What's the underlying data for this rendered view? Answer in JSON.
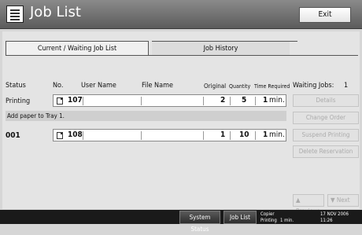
{
  "title_bar": {
    "title": "Job List",
    "exit_label": "Exit"
  },
  "tabs": [
    {
      "label": "Current / Waiting Job List",
      "active": true
    },
    {
      "label": "Job History",
      "active": false
    }
  ],
  "columns": {
    "status": "Status",
    "no": "No.",
    "user_name": "User Name",
    "file_name": "File Name",
    "original": "Original",
    "quantity": "Quantity",
    "time_required": "Time Required"
  },
  "waiting_jobs": {
    "label": "Waiting Jobs:",
    "count": "1"
  },
  "jobs": [
    {
      "status": "Printing",
      "no": "107",
      "user_name": "",
      "file_name": "",
      "original": "2",
      "quantity": "5",
      "time": "1",
      "time_unit": "min."
    },
    {
      "status": "001",
      "no": "108",
      "user_name": "",
      "file_name": "",
      "original": "1",
      "quantity": "10",
      "time": "1",
      "time_unit": "min."
    }
  ],
  "message": "Add paper to Tray 1.",
  "side_buttons": {
    "details": "Details",
    "change_order": "Change Order",
    "suspend_printing": "Suspend Printing",
    "delete_reservation": "Delete Reservation"
  },
  "nav": {
    "previous": "Previous",
    "next": "Next"
  },
  "footer": {
    "system_status": "System Status",
    "job_list": "Job List",
    "mode": "Copier",
    "state": "Printing",
    "remaining": "1 min.",
    "date": "17 NOV  2006",
    "time": "11:26"
  },
  "colors": {
    "title_bar": "#6f6f6f",
    "footer": "#1a1a1a",
    "disabled_text": "#ababab"
  }
}
